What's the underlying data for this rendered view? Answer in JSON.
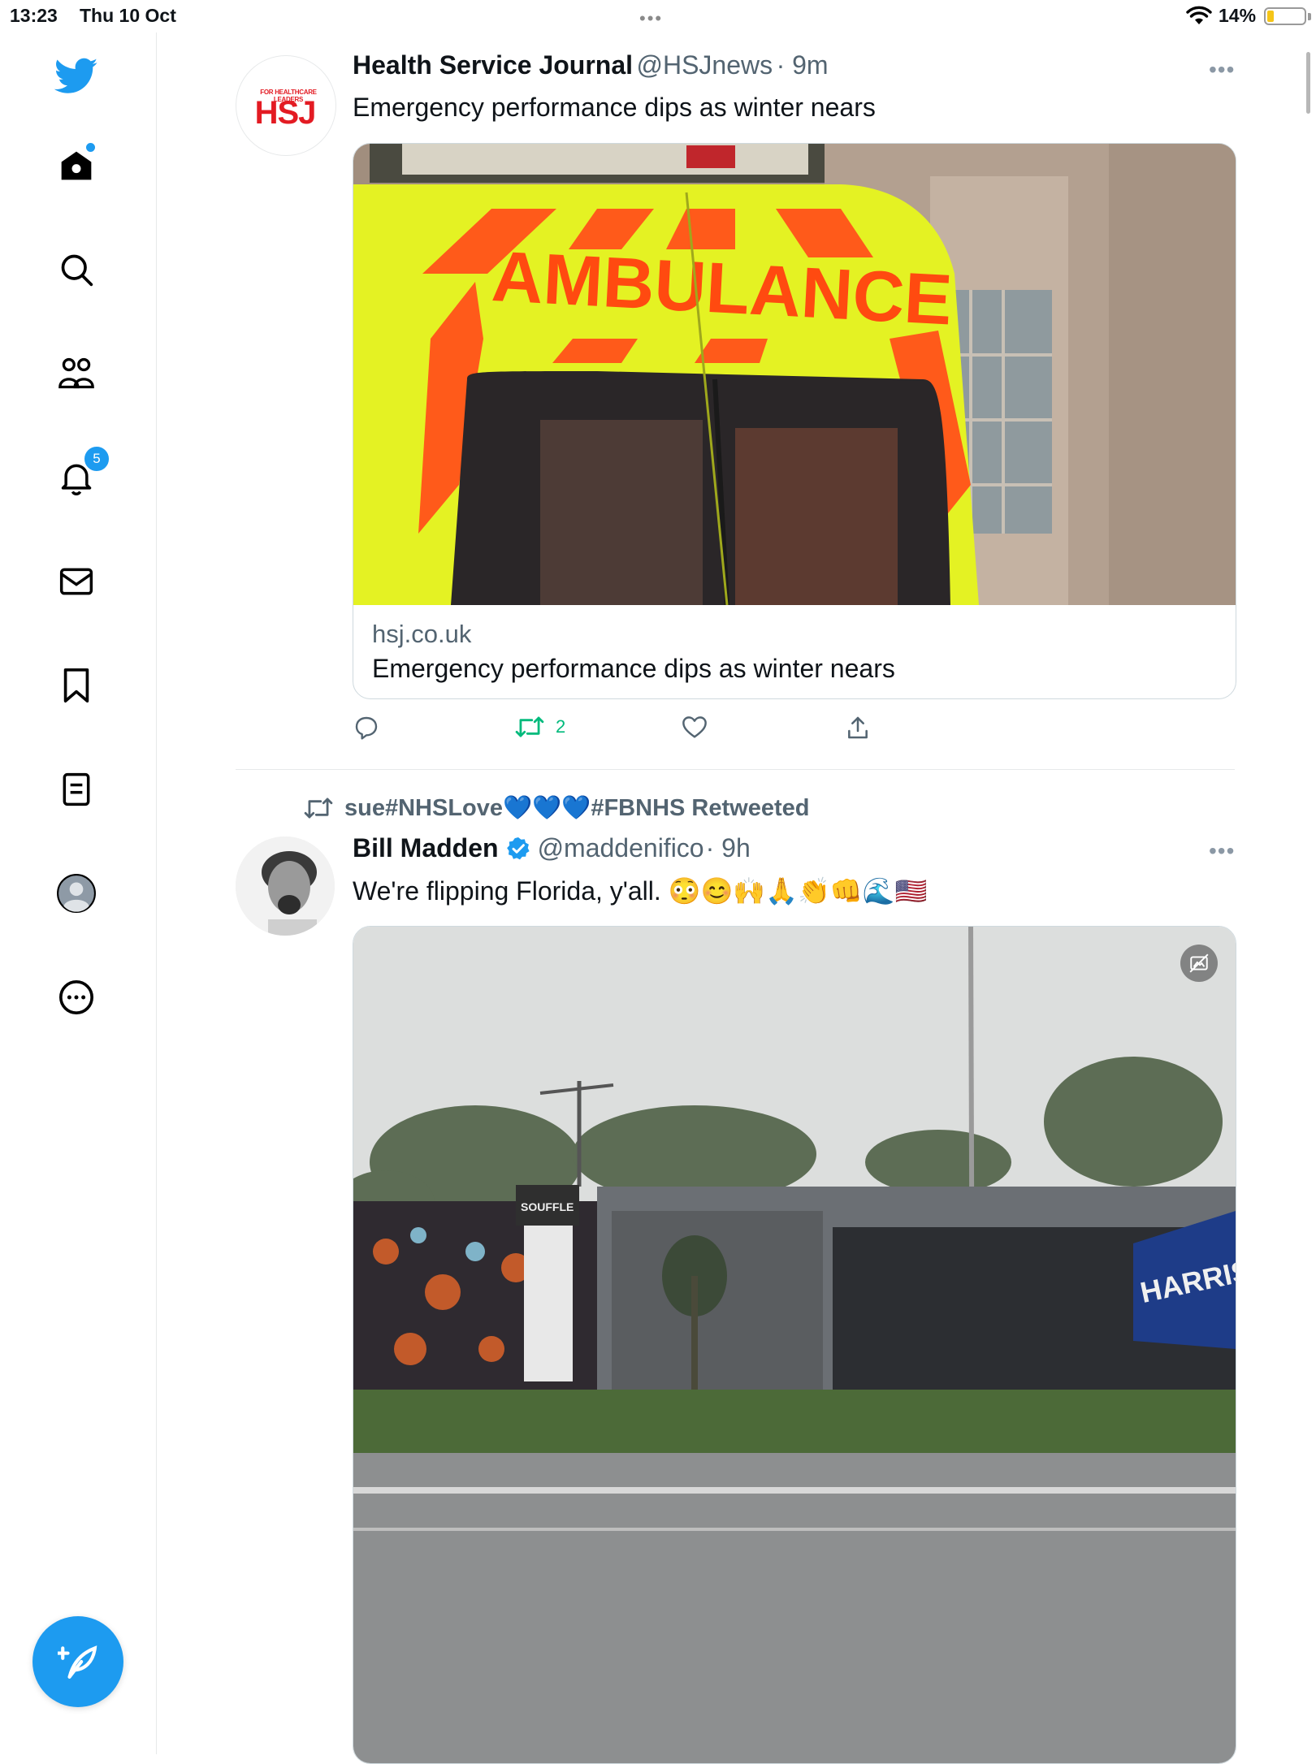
{
  "status_bar": {
    "time": "13:23",
    "date": "Thu 10 Oct",
    "battery": "14%"
  },
  "sidebar": {
    "notifications_count": "5",
    "items": [
      "twitter-logo",
      "home",
      "search",
      "communities",
      "notifications",
      "messages",
      "bookmarks",
      "lists",
      "profile",
      "more"
    ]
  },
  "tweets": [
    {
      "author_name": "Health Service Journal",
      "handle": "@HSJnews",
      "time": "· 9m",
      "avatar_logo_text": "HSJ",
      "avatar_logo_tagline": "FOR HEALTHCARE LEADERS",
      "text": "Emergency performance dips as winter nears",
      "card": {
        "domain": "hsj.co.uk",
        "title": "Emergency performance dips as winter nears",
        "image_text": "AMBULANCE"
      },
      "actions": {
        "retweets": "2"
      }
    },
    {
      "retweeted_by": "sue#NHSLove💙💙💙#FBNHS Retweeted",
      "author_name": "Bill Madden",
      "handle": "@maddenifico",
      "time": "· 9h",
      "text": "We're flipping Florida, y'all. 😳😊🙌🙏👏👊🌊🇺🇸",
      "media_sign_text": "SOUFFLE",
      "media_flag_text": "HARRIS WALZ"
    }
  ],
  "colors": {
    "accent": "#1d9bf0",
    "retweet_green": "#00ba7c",
    "text": "#0f1419",
    "secondary": "#536471",
    "hsj_red": "#e31b23"
  }
}
